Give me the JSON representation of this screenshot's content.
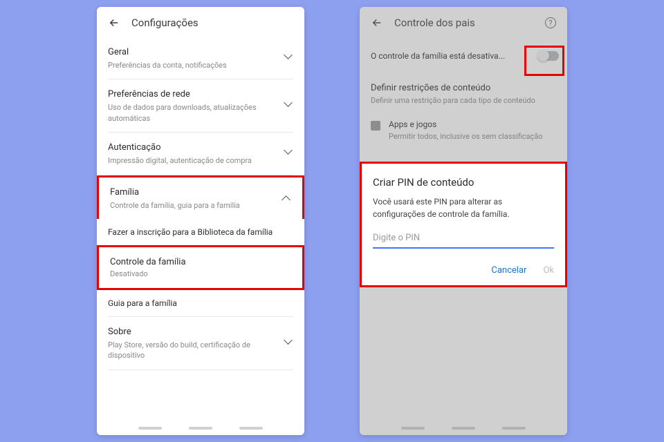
{
  "left": {
    "header_title": "Configurações",
    "sections": [
      {
        "title": "Geral",
        "sub": "Preferências da conta, notificações"
      },
      {
        "title": "Preferências de rede",
        "sub": "Uso de dados para downloads, atualizações automáticas"
      },
      {
        "title": "Autenticação",
        "sub": "Impressão digital, autenticação de compra"
      },
      {
        "title": "Família",
        "sub": "Controle da família, guia para a família"
      }
    ],
    "sub_items": [
      {
        "label": "Fazer a inscrição para a Biblioteca da família"
      },
      {
        "label": "Controle da família",
        "sub": "Desativado"
      },
      {
        "label": "Guia para a família"
      }
    ],
    "about": {
      "title": "Sobre",
      "sub": "Play Store, versão do build, certificação de dispositivo"
    }
  },
  "right": {
    "header_title": "Controle dos pais",
    "status_row": "O controle da família está desativa...",
    "restriction_title": "Definir restrições de conteúdo",
    "restriction_sub": "Definir uma restrição para cada tipo de conteúdo",
    "apps_title": "Apps e jogos",
    "apps_sub": "Permitir todos, inclusive os sem classificação",
    "dialog": {
      "title": "Criar PIN de conteúdo",
      "body": "Você usará este PIN para alterar as configurações de controle da família.",
      "placeholder": "Digite o PIN",
      "cancel": "Cancelar",
      "ok": "Ok"
    }
  }
}
